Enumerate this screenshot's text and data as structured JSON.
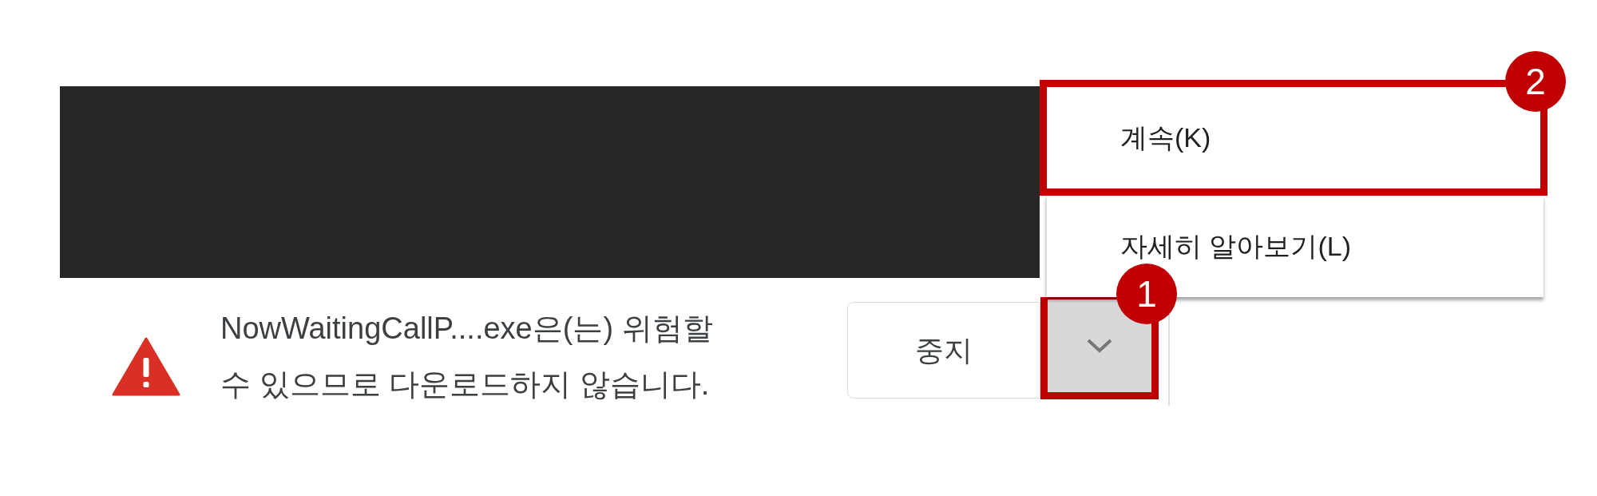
{
  "download_bar": {
    "warning": "NowWaitingCallP....exe은(는) 위험할 수 있으므로 다운로드하지 않습니다.",
    "buttons": [
      {
        "kind": "text",
        "label": "중지"
      },
      {
        "kind": "dropdown",
        "selected": true,
        "annotation": "1"
      }
    ]
  },
  "menu": {
    "items": [
      {
        "label": "계속(K)",
        "selected": false,
        "annotation": "2"
      },
      {
        "label": "자세히 알아보기(L)",
        "selected": false
      }
    ]
  }
}
